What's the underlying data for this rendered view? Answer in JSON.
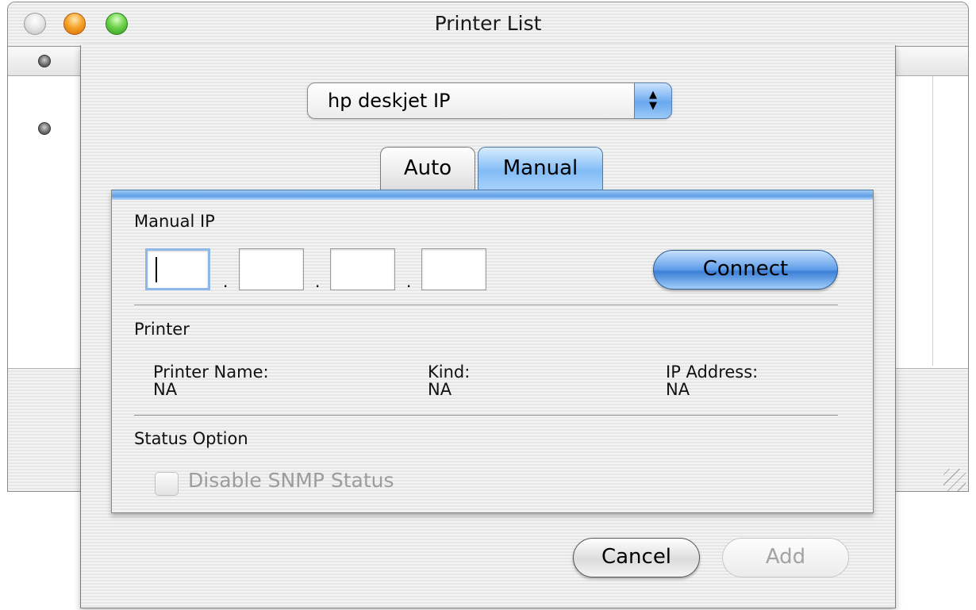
{
  "window": {
    "title": "Printer List"
  },
  "sheet": {
    "printer_type": "hp deskjet IP",
    "tabs": [
      {
        "label": "Auto",
        "selected": false
      },
      {
        "label": "Manual",
        "selected": true
      }
    ],
    "manual_ip": {
      "section_label": "Manual IP",
      "fields": [
        "",
        "",
        "",
        ""
      ],
      "separator": ".",
      "connect_label": "Connect"
    },
    "printer": {
      "section_label": "Printer",
      "name_label": "Printer Name:",
      "name_value": "NA",
      "kind_label": "Kind:",
      "kind_value": "NA",
      "ip_label": "IP Address:",
      "ip_value": "NA"
    },
    "status_option": {
      "section_label": "Status Option",
      "checkbox_label": "Disable SNMP Status",
      "checked": false,
      "enabled": false
    },
    "buttons": {
      "cancel": "Cancel",
      "add": "Add"
    }
  },
  "colors": {
    "accent_blue": "#6aa8ef",
    "disabled_text": "#9c9c9c"
  }
}
